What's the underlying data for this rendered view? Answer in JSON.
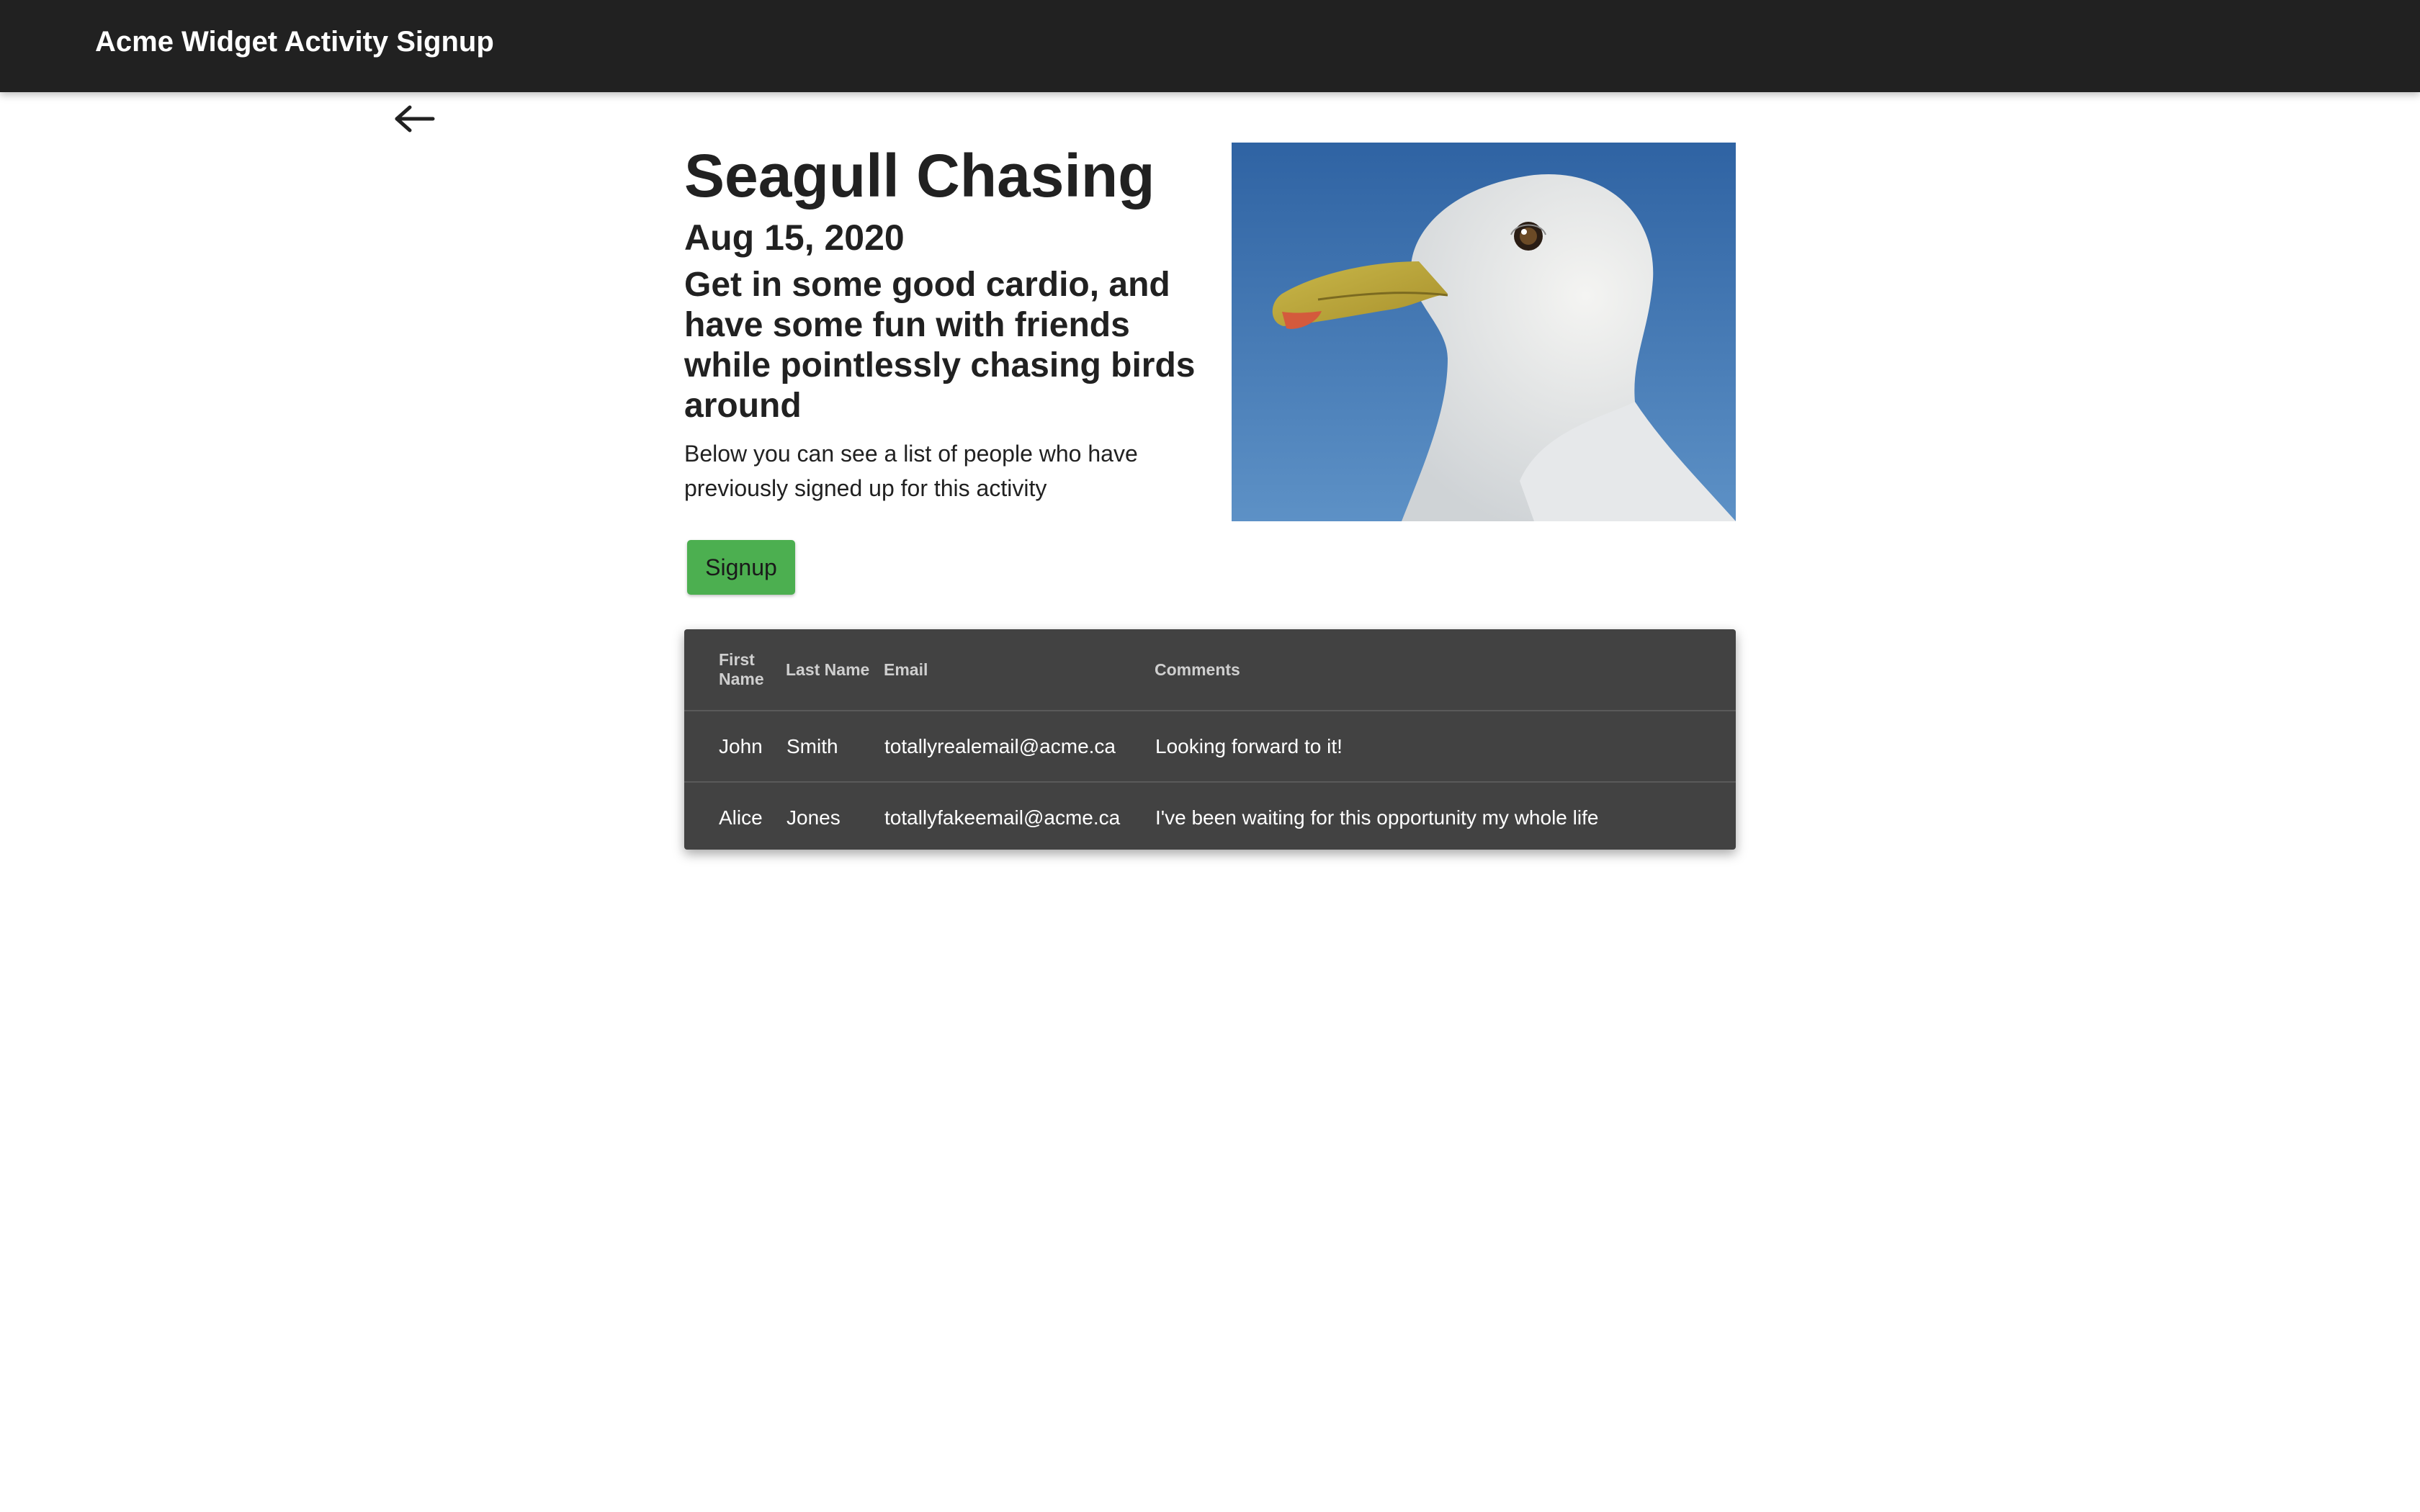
{
  "header": {
    "title": "Acme Widget Activity Signup"
  },
  "nav": {
    "back_icon": "arrow-left-icon"
  },
  "activity": {
    "title": "Seagull Chasing",
    "date": "Aug 15, 2020",
    "tagline": "Get in some good cardio, and have some fun with friends while pointlessly chasing birds around",
    "description": "Below you can see a list of people who have previously signed up for this activity",
    "signup_label": "Signup",
    "image_alt": "seagull photo"
  },
  "signups": {
    "columns": [
      "First Name",
      "Last Name",
      "Email",
      "Comments"
    ],
    "rows": [
      {
        "first": "John",
        "last": "Smith",
        "email": "totallyrealemail@acme.ca",
        "comment": "Looking forward to it!"
      },
      {
        "first": "Alice",
        "last": "Jones",
        "email": "totallyfakeemail@acme.ca",
        "comment": "I've been waiting for this opportunity my whole life"
      }
    ]
  },
  "colors": {
    "appbar": "#212121",
    "signup_button": "#4caf50",
    "table_background": "#424242",
    "sky": "#3d70a8"
  }
}
